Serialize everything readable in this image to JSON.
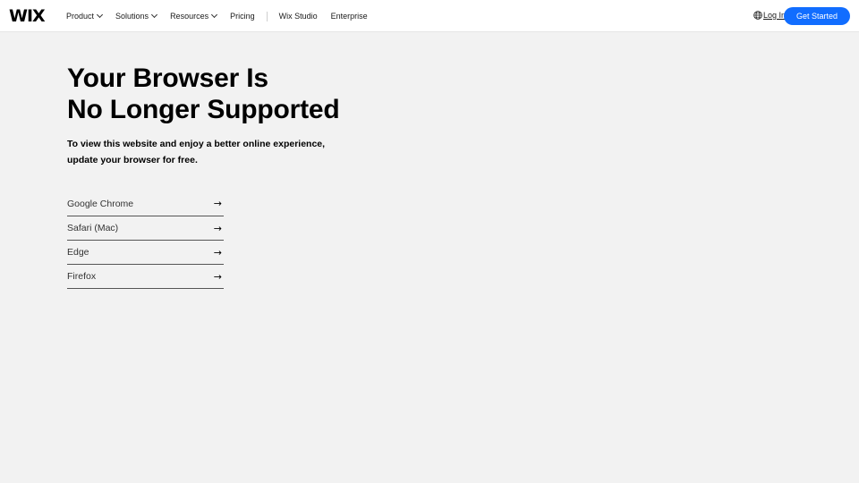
{
  "header": {
    "logo": "WIX",
    "nav": [
      {
        "label": "Product",
        "has_dropdown": true
      },
      {
        "label": "Solutions",
        "has_dropdown": true
      },
      {
        "label": "Resources",
        "has_dropdown": true
      },
      {
        "label": "Pricing",
        "has_dropdown": false
      }
    ],
    "nav_secondary": [
      {
        "label": "Wix Studio"
      },
      {
        "label": "Enterprise"
      }
    ],
    "login_label": "Log In",
    "cta_label": "Get Started",
    "accent_color": "#116dff"
  },
  "main": {
    "title_line1": "Your Browser Is",
    "title_line2": "No Longer Supported",
    "subtitle": "To view this website and enjoy a better online experience, update your browser for free.",
    "browsers": [
      {
        "label": "Google Chrome",
        "icon": "arrow-right-icon"
      },
      {
        "label": "Safari (Mac)",
        "icon": "arrow-right-icon"
      },
      {
        "label": "Edge",
        "icon": "arrow-right-icon"
      },
      {
        "label": "Firefox",
        "icon": "arrow-right-icon"
      }
    ]
  }
}
